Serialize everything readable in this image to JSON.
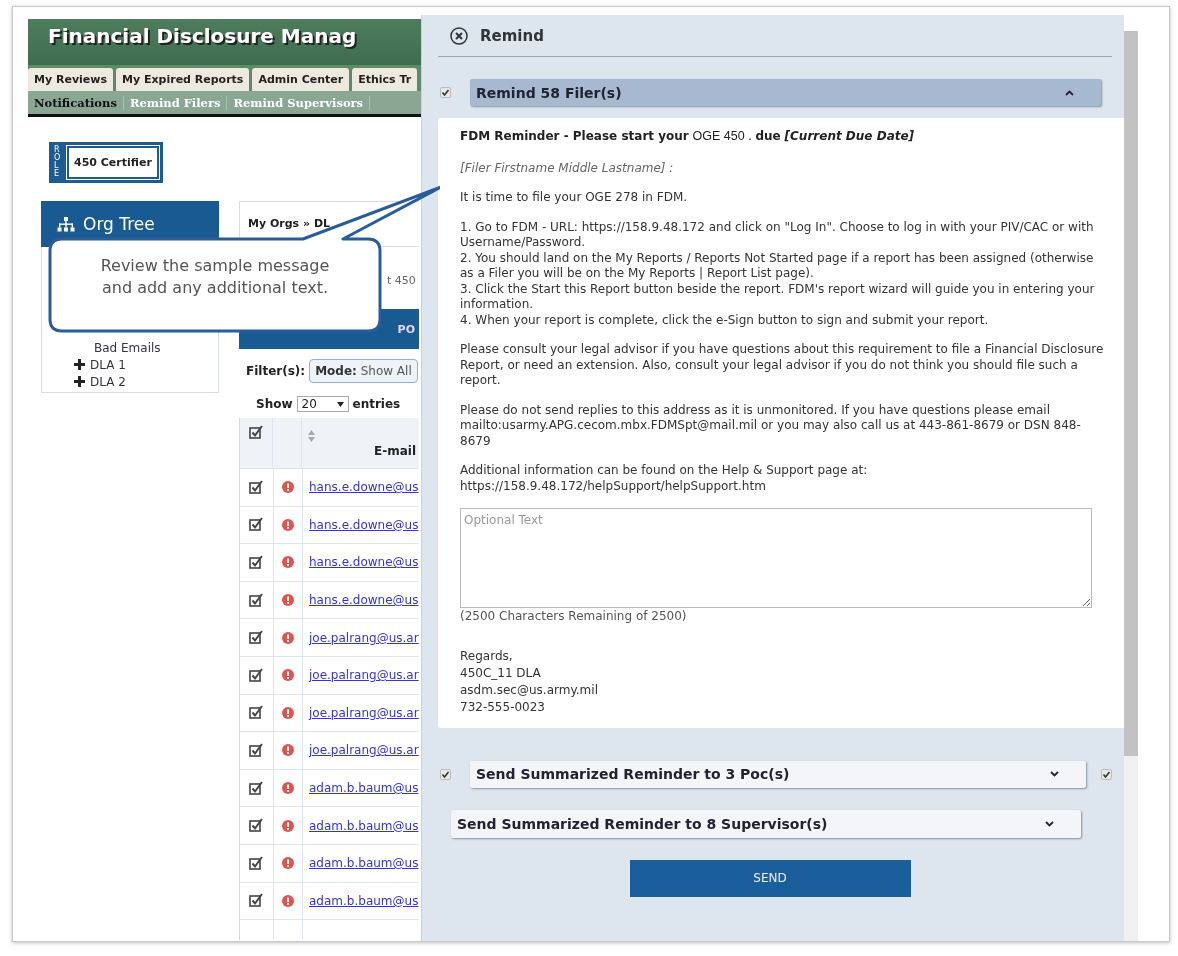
{
  "app": {
    "banner_title": "Financial Disclosure Manag",
    "nav_tabs": [
      {
        "label": "My Reviews",
        "selected": false
      },
      {
        "label": "My Expired Reports",
        "selected": false
      },
      {
        "label": "Admin Center",
        "selected": false
      },
      {
        "label": "Ethics Tr",
        "selected": false
      }
    ],
    "sub_nav": [
      {
        "label": "Notifications",
        "selected": true
      },
      {
        "label": "Remind Filers",
        "selected": false
      },
      {
        "label": "Remind Supervisors",
        "selected": false
      }
    ],
    "role": {
      "tag": "ROLE",
      "value": "450 Certifier"
    }
  },
  "org_tree": {
    "title": "Org Tree",
    "items": [
      {
        "label": "Bad Emails",
        "kind": "leaf"
      },
      {
        "label": "DLA 1",
        "kind": "collapsed"
      },
      {
        "label": "DLA 2",
        "kind": "collapsed"
      }
    ]
  },
  "main": {
    "breadcrumb": "My Orgs » DL",
    "subtitle": "t 450",
    "tab_bar_label": "PO",
    "filter_label": "Filter(s):",
    "filter_mode_label": "Mode:",
    "filter_mode_value": "Show All",
    "show_label": "Show",
    "page_size": "20",
    "entries_label": "entries",
    "table": {
      "header_checked": true,
      "email_header": "E-mail",
      "rows": [
        {
          "email": "hans.e.downe@us",
          "checked": true
        },
        {
          "email": "hans.e.downe@us",
          "checked": true
        },
        {
          "email": "hans.e.downe@us",
          "checked": true
        },
        {
          "email": "hans.e.downe@us",
          "checked": true
        },
        {
          "email": "joe.palrang@us.ar",
          "checked": true
        },
        {
          "email": "joe.palrang@us.ar",
          "checked": true
        },
        {
          "email": "joe.palrang@us.ar",
          "checked": true
        },
        {
          "email": "joe.palrang@us.ar",
          "checked": true
        },
        {
          "email": "adam.b.baum@us",
          "checked": true
        },
        {
          "email": "adam.b.baum@us",
          "checked": true
        },
        {
          "email": "adam.b.baum@us",
          "checked": true
        },
        {
          "email": "adam.b.baum@us",
          "checked": true
        }
      ]
    }
  },
  "callout": {
    "lines": [
      "Review the sample message",
      "and add any additional text."
    ]
  },
  "panel": {
    "title": "Remind",
    "sections": [
      {
        "label": "Remind 58 Filer(s)",
        "expanded": true,
        "checked": true
      },
      {
        "label": "Send Summarized Reminder to 3 Poc(s)",
        "expanded": false,
        "checked": true,
        "extra_checked": true
      },
      {
        "label": "Send Summarized Reminder to 8 Supervisor(s)",
        "expanded": false
      }
    ],
    "message": {
      "subject_lead": "FDM Reminder - Please start your",
      "subject_report": "OGE 450 .",
      "subject_due": "due",
      "subject_date": "[Current Due Date]",
      "salutation": "[Filer Firstname Middle Lastname] :",
      "intro": "It is time to file your OGE 278 in FDM.",
      "steps": [
        "1. Go to FDM - URL: https://158.9.48.172 and click on \"Log In\". Choose to log in with your PIV/CAC or with Username/Password.",
        "2. You should land on the My Reports / Reports Not Started page if a report has been assigned (otherwise as a Filer you will be on the My Reports | Report List page).",
        "3. Click the Start this Report button beside the report. FDM's report wizard will guide you in entering your information.",
        "4. When your report is complete, click the e-Sign button to sign and submit your report."
      ],
      "paragraphs": [
        "Please consult your legal advisor if you have questions about this requirement to file a Financial Disclosure Report, or need an extension. Also, consult your legal advisor if you do not think you should file such a report.",
        "Please do not send replies to this address as it is unmonitored. If you have questions please email mailto:usarmy.APG.cecom.mbx.FDMSpt@mail.mil or you may also call us at 443-861-8679 or DSN 848-8679",
        "Additional information can be found on the Help & Support page at: https://158.9.48.172/helpSupport/helpSupport.htm"
      ],
      "optional_text": {
        "placeholder": "Optional Text"
      },
      "char_count": "(2500 Characters Remaining of 2500)",
      "signature": [
        "Regards,",
        "450C_11 DLA",
        "asdm.sec@us.army.mil",
        "732-555-0023"
      ]
    },
    "send_button": "SEND"
  }
}
